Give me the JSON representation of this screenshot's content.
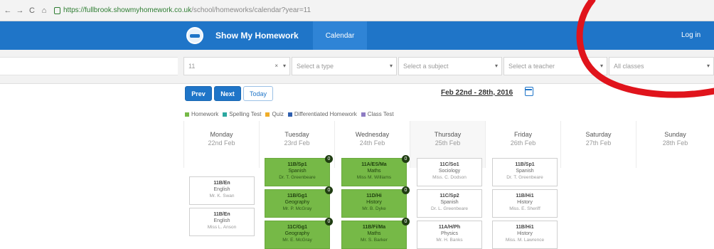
{
  "browser": {
    "url_host": "https://fullbrook.showmyhomework.co.uk",
    "url_path": "/school/homeworks/calendar?year=11",
    "back": "←",
    "forward": "→",
    "reload": "C",
    "home": "⌂"
  },
  "header": {
    "brand": "Show My Homework",
    "nav_calendar": "Calendar",
    "login": "Log in"
  },
  "filters": {
    "year": "11",
    "type": "Select a type",
    "subject": "Select a subject",
    "teacher": "Select a teacher",
    "class": "All classes"
  },
  "controls": {
    "prev": "Prev",
    "next": "Next",
    "today": "Today",
    "date_range": "Feb 22nd - 28th, 2016"
  },
  "legend": [
    {
      "label": "Homework",
      "color": "#76b947"
    },
    {
      "label": "Spelling Test",
      "color": "#2ba8a0"
    },
    {
      "label": "Quiz",
      "color": "#f0ad29"
    },
    {
      "label": "Differentiated Homework",
      "color": "#2f5fae"
    },
    {
      "label": "Class Test",
      "color": "#8e7cc3"
    }
  ],
  "days": [
    {
      "name": "Monday",
      "date": "22nd Feb"
    },
    {
      "name": "Tuesday",
      "date": "23rd Feb"
    },
    {
      "name": "Wednesday",
      "date": "24th Feb"
    },
    {
      "name": "Thursday",
      "date": "25th Feb"
    },
    {
      "name": "Friday",
      "date": "26th Feb"
    },
    {
      "name": "Saturday",
      "date": "27th Feb"
    },
    {
      "name": "Sunday",
      "date": "28th Feb"
    }
  ],
  "cards": {
    "mon": [
      {
        "cls": "11B/En",
        "subject": "English",
        "teacher": "Mr. K. Swan"
      },
      {
        "cls": "11B/En",
        "subject": "English",
        "teacher": "Miss L. Anson"
      }
    ],
    "tue": [
      {
        "cls": "11B/Sp1",
        "subject": "Spanish",
        "teacher": "Dr. T. Greenbeare",
        "badge": "0"
      },
      {
        "cls": "11B/Gg1",
        "subject": "Geography",
        "teacher": "Mr. P. McGray",
        "badge": "0"
      },
      {
        "cls": "11C/Gg1",
        "subject": "Geography",
        "teacher": "Mr. E. McGray",
        "badge": "0"
      }
    ],
    "wed": [
      {
        "cls": "11A/ES/Ma",
        "subject": "Maths",
        "teacher": "Miss M. Williams",
        "badge": "0"
      },
      {
        "cls": "11D/Hi",
        "subject": "History",
        "teacher": "Mr. B. Dyke",
        "badge": "0"
      },
      {
        "cls": "11B/Fi/Ma",
        "subject": "Maths",
        "teacher": "Mr. S. Barker",
        "badge": "0"
      }
    ],
    "thu": [
      {
        "cls": "11C/So1",
        "subject": "Sociology",
        "teacher": "Miss. C. Dodson"
      },
      {
        "cls": "11C/Sp2",
        "subject": "Spanish",
        "teacher": "Dr. L. Greenbeare"
      },
      {
        "cls": "11A/H/Ph",
        "subject": "Physics",
        "teacher": "Mr. H. Banks"
      }
    ],
    "fri": [
      {
        "cls": "11B/Sp1",
        "subject": "Spanish",
        "teacher": "Dr. T. Greenbeare"
      },
      {
        "cls": "11B/Hi1",
        "subject": "History",
        "teacher": "Miss. E. Sheriff"
      },
      {
        "cls": "11B/Hi1",
        "subject": "History",
        "teacher": "Miss. M. Lawrence"
      }
    ]
  },
  "annotation_color": "#e0141c"
}
